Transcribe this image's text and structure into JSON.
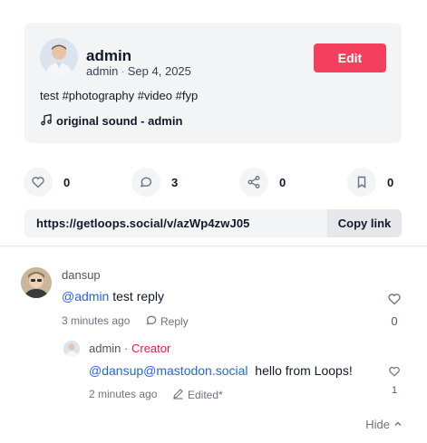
{
  "post": {
    "author": "admin",
    "username": "admin",
    "separator": "·",
    "date": "Sep 4, 2025",
    "edit_label": "Edit",
    "caption": "test #photography #video #fyp",
    "sound": "original sound - admin"
  },
  "actions": {
    "likes": "0",
    "comments": "3",
    "shares": "0",
    "bookmarks": "0"
  },
  "share": {
    "url": "https://getloops.social/v/azWp4zwJ05",
    "copy_label": "Copy link"
  },
  "comments": [
    {
      "user": "dansup",
      "mention": "@admin",
      "text": " test reply",
      "time": "3 minutes ago",
      "reply_label": "Reply",
      "likes": "0",
      "replies": [
        {
          "user": "admin",
          "badge": "· Creator",
          "mention": "@dansup@mastodon.social",
          "text": "  hello from Loops!",
          "time": "2 minutes ago",
          "edited_label": "Edited*",
          "likes": "1"
        }
      ]
    }
  ],
  "hide_label": "Hide",
  "colors": {
    "accent": "#f43f5e",
    "mention": "#2563eb",
    "creator": "#e11d48",
    "surface": "#f3f4f6"
  },
  "icons": [
    "heart-icon",
    "comment-icon",
    "share-icon",
    "bookmark-icon",
    "music-note-icon",
    "reply-icon",
    "pencil-icon",
    "chevron-up-icon"
  ]
}
